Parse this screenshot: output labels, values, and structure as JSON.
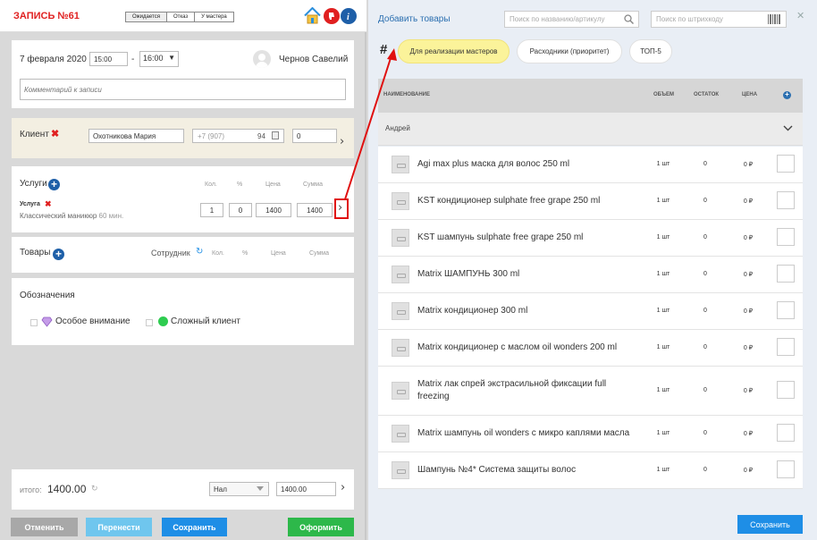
{
  "header": {
    "title": "ЗАПИСЬ №61",
    "status_tabs": [
      "Ожидается",
      "Отказ",
      "У мастера"
    ],
    "active_tab": 0
  },
  "appointment": {
    "date": "7 февраля 2020",
    "time_from": "15:00",
    "time_sep": "-",
    "time_to": "16:00",
    "employee": "Чернов Савелий",
    "comment_placeholder": "Комментарий к записи"
  },
  "client": {
    "label": "Клиент",
    "name": "Охотникова Мария",
    "phone": "+7 (907)",
    "phone_tail": "94",
    "discount": "0"
  },
  "services": {
    "label": "Услуги",
    "cols": {
      "qty": "Кол.",
      "pct": "%",
      "price": "Цена",
      "sum": "Сумма"
    },
    "item": {
      "title": "Услуга",
      "name": "Классический маникюр",
      "duration": "60 мин.",
      "qty": "1",
      "pct": "0",
      "price": "1400",
      "sum": "1400"
    }
  },
  "goods": {
    "label": "Товары",
    "employee_col": "Сотрудник",
    "cols": {
      "qty": "Кол.",
      "pct": "%",
      "price": "Цена",
      "sum": "Сумма"
    }
  },
  "marks": {
    "label": "Обозначения",
    "items": [
      "Особое внимание",
      "Сложный клиент"
    ]
  },
  "total": {
    "label": "итого:",
    "value": "1400.00",
    "pay_method": "Нал",
    "pay_amount": "1400.00"
  },
  "footer_buttons": {
    "cancel": "Отменить",
    "move": "Перенести",
    "save": "Сохранить",
    "checkout": "Оформить"
  },
  "panel": {
    "title": "Добавить товары",
    "search_placeholder": "Поиск по названию/артикулу",
    "barcode_placeholder": "Поиск по штрихкоду",
    "hash": "#",
    "filters": [
      "Для реализации мастеров",
      "Расходники (приоритет)",
      "ТОП-5"
    ],
    "active_filter": 0,
    "columns": {
      "name": "НАИМЕНОВАНИЕ",
      "volume": "ОБЪЕМ",
      "stock": "ОСТАТОК",
      "price": "ЦЕНА"
    },
    "group": "Андрей",
    "products": [
      {
        "name": "Agi max plus маска для волос 250 ml",
        "volume": "1 шт",
        "stock": "0",
        "price": "0 ₽"
      },
      {
        "name": "KST кондиционер sulphate free grape 250 ml",
        "volume": "1 шт",
        "stock": "0",
        "price": "0 ₽"
      },
      {
        "name": "KST шампунь sulphate free grape 250 ml",
        "volume": "1 шт",
        "stock": "0",
        "price": "0 ₽"
      },
      {
        "name": "Matrix ШАМПУНЬ 300 ml",
        "volume": "1 шт",
        "stock": "0",
        "price": "0 ₽"
      },
      {
        "name": "Matrix кондиционер 300 ml",
        "volume": "1 шт",
        "stock": "0",
        "price": "0 ₽"
      },
      {
        "name": "Matrix кондиционер с маслом oil wonders 200 ml",
        "volume": "1 шт",
        "stock": "0",
        "price": "0 ₽"
      },
      {
        "name": "Matrix лак спрей экстрасильной фиксации full freezing",
        "volume": "1 шт",
        "stock": "0",
        "price": "0 ₽"
      },
      {
        "name": "Matrix шампунь oil wonders с микро каплями масла",
        "volume": "1 шт",
        "stock": "0",
        "price": "0 ₽"
      },
      {
        "name": "Шампунь №4* Система защиты волос",
        "volume": "1 шт",
        "stock": "0",
        "price": "0 ₽"
      }
    ],
    "save": "Сохранить"
  },
  "colors": {
    "title_red": "#e02020",
    "accent_blue": "#2b8fdc",
    "cancel_gray": "#a8a8a8",
    "move_blue": "#6fc6ee",
    "save_blue": "#1e8ee6",
    "checkout_green": "#2db84a",
    "client_bg": "#f3efe2",
    "pill_yellow": "#fbf39a",
    "annotation_red": "#e01010"
  }
}
